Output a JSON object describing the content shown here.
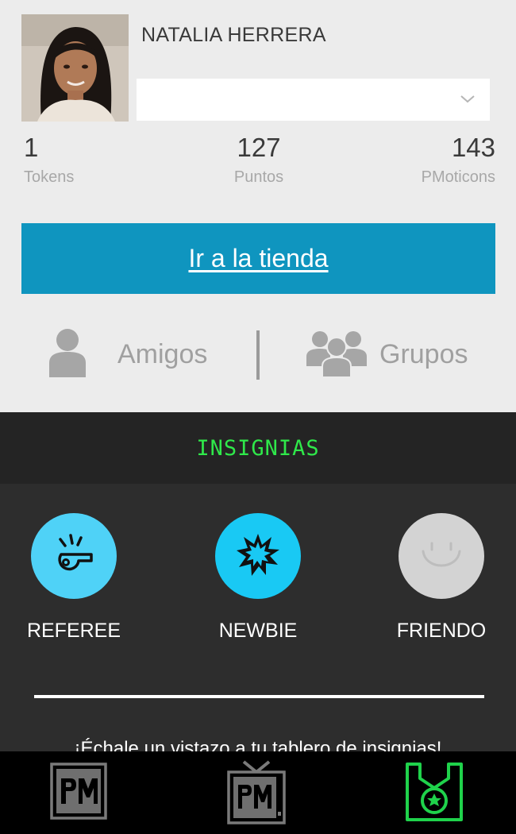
{
  "profile": {
    "name": "NATALIA HERRERA",
    "dropdown_value": ""
  },
  "stats": [
    {
      "value": "1",
      "label": "Tokens"
    },
    {
      "value": "127",
      "label": "Puntos"
    },
    {
      "value": "143",
      "label": "PMoticons"
    }
  ],
  "store_button": "Ir a la tienda",
  "social": {
    "friends_label": "Amigos",
    "groups_label": "Grupos"
  },
  "badges": {
    "header": "INSIGNIAS",
    "items": [
      {
        "name": "REFEREE",
        "icon": "whistle-icon",
        "color": "#4fd2f7",
        "unlocked": true
      },
      {
        "name": "NEWBIE",
        "icon": "starburst-icon",
        "color": "#19c9f4",
        "unlocked": true
      },
      {
        "name": "FRIENDO",
        "icon": "smiley-icon",
        "color": "#d3d3d3",
        "unlocked": false
      }
    ],
    "cta": "¡Échale un vistazo a tu tablero de insignias!"
  },
  "tabbar": {
    "tabs": [
      {
        "icon": "pm-logo-icon",
        "active": false
      },
      {
        "icon": "pm-tv-icon",
        "active": false
      },
      {
        "icon": "medal-icon",
        "active": true
      }
    ],
    "active_color": "#1fd24b",
    "inactive_color": "#7a7a7a"
  },
  "colors": {
    "accent_blue": "#0f95bf",
    "insignias_green": "#2fe84a"
  }
}
